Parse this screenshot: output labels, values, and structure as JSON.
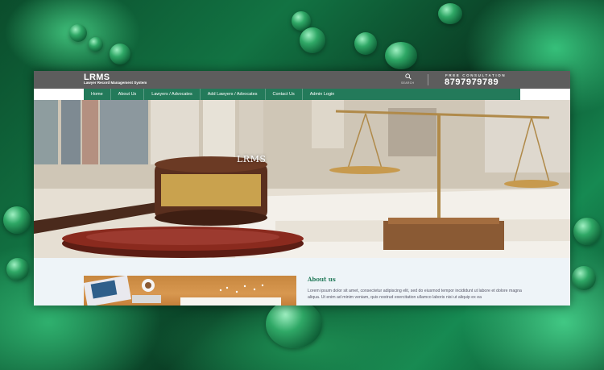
{
  "header": {
    "logo": "LRMS",
    "tagline": "Lawyer Record Management System",
    "search_label": "SEARCH",
    "consultation_label": "FREE CONSULTATION",
    "phone": "8797979789"
  },
  "nav": {
    "items": [
      {
        "label": "Home"
      },
      {
        "label": "About Us"
      },
      {
        "label": "Lawyers / Advocates"
      },
      {
        "label": "Add Lawyers / Advocates"
      },
      {
        "label": "Contact Us"
      },
      {
        "label": "Admin Login"
      }
    ]
  },
  "hero": {
    "title": "LRMS"
  },
  "about": {
    "heading": "About us",
    "text": "Lorem ipsum dolor sit amet, consectetur adipiscing elit, sed do eiusmod tempor incididunt ut labore et dolore magna aliqua. Ut enim ad minim veniam, quis nostrud exercitation ullamco laboris nisi ut aliquip ex ea"
  },
  "colors": {
    "nav": "#237a5a",
    "topbar": "#5d5d5d",
    "accent": "#237a5a"
  }
}
